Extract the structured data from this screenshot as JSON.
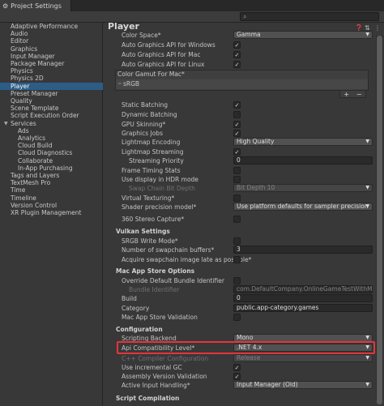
{
  "window": {
    "title": "Project Settings"
  },
  "sidebar": {
    "items": [
      {
        "label": "Adaptive Performance"
      },
      {
        "label": "Audio"
      },
      {
        "label": "Editor"
      },
      {
        "label": "Graphics"
      },
      {
        "label": "Input Manager"
      },
      {
        "label": "Package Manager"
      },
      {
        "label": "Physics"
      },
      {
        "label": "Physics 2D"
      },
      {
        "label": "Player",
        "selected": true
      },
      {
        "label": "Preset Manager"
      },
      {
        "label": "Quality"
      },
      {
        "label": "Scene Template"
      },
      {
        "label": "Script Execution Order"
      },
      {
        "label": "Services",
        "expanded": true
      },
      {
        "label": "Ads"
      },
      {
        "label": "Analytics"
      },
      {
        "label": "Cloud Build"
      },
      {
        "label": "Cloud Diagnostics"
      },
      {
        "label": "Collaborate"
      },
      {
        "label": "In-App Purchasing"
      },
      {
        "label": "Tags and Layers"
      },
      {
        "label": "TextMesh Pro"
      },
      {
        "label": "Time"
      },
      {
        "label": "Timeline"
      },
      {
        "label": "Version Control"
      },
      {
        "label": "XR Plugin Management"
      }
    ]
  },
  "main": {
    "title": "Player",
    "header_icons": [
      "help-icon",
      "presets-icon",
      "menu-icon"
    ],
    "rows": {
      "color_space": {
        "label": "Color Space*",
        "value": "Gamma"
      },
      "auto_gfx_windows": {
        "label": "Auto Graphics API  for Windows",
        "checked": true
      },
      "auto_gfx_mac": {
        "label": "Auto Graphics API  for Mac",
        "checked": true
      },
      "auto_gfx_linux": {
        "label": "Auto Graphics API  for Linux",
        "checked": true
      },
      "color_gamut": {
        "title": "Color Gamut For Mac*",
        "value": "sRGB",
        "add": "+",
        "remove": "−"
      },
      "static_batching": {
        "label": "Static Batching",
        "checked": true
      },
      "dynamic_batching": {
        "label": "Dynamic Batching",
        "checked": false
      },
      "gpu_skinning": {
        "label": "GPU Skinning*",
        "checked": true
      },
      "graphics_jobs": {
        "label": "Graphics Jobs",
        "checked": true
      },
      "lightmap_encoding": {
        "label": "Lightmap Encoding",
        "value": "High Quality"
      },
      "lightmap_streaming": {
        "label": "Lightmap Streaming",
        "checked": true
      },
      "streaming_priority": {
        "label": "Streaming Priority",
        "value": "0"
      },
      "frame_timing": {
        "label": "Frame Timing Stats",
        "checked": false
      },
      "hdr_display": {
        "label": "Use display in HDR mode",
        "checked": false
      },
      "swap_chain_depth": {
        "label": "Swap Chain Bit Depth",
        "value": "Bit Depth 10"
      },
      "virtual_texturing": {
        "label": "Virtual Texturing*",
        "checked": false
      },
      "shader_precision": {
        "label": "Shader precision model*",
        "value": "Use platform defaults for sampler precision"
      },
      "stereo_capture": {
        "label": "360 Stereo Capture*",
        "checked": false
      },
      "vulkan_section": {
        "label": "Vulkan Settings"
      },
      "srgb_write": {
        "label": "SRGB Write Mode*",
        "checked": false
      },
      "swapchain_buffers": {
        "label": "Number of swapchain buffers*",
        "value": "3"
      },
      "acquire_late": {
        "label": "Acquire swapchain image late as possible*",
        "checked": false
      },
      "mac_store_section": {
        "label": "Mac App Store Options"
      },
      "override_bundle": {
        "label": "Override Default Bundle Identifier",
        "checked": false
      },
      "bundle_identifier": {
        "label": "Bundle Identifier",
        "value": "com.DefaultCompany.OnlineGameTestWithMirror"
      },
      "build": {
        "label": "Build",
        "value": "0"
      },
      "category": {
        "label": "Category",
        "value": "public.app-category.games"
      },
      "mac_store_validation": {
        "label": "Mac App Store Validation",
        "checked": false
      },
      "config_section": {
        "label": "Configuration"
      },
      "scripting_backend": {
        "label": "Scripting Backend",
        "value": "Mono"
      },
      "api_compat": {
        "label": "Api Compatibility Level*",
        "value": ".NET 4.x"
      },
      "cpp_compiler": {
        "label": "C++ Compiler Configuration",
        "value": "Release"
      },
      "incremental_gc": {
        "label": "Use incremental GC",
        "checked": true
      },
      "assembly_validation": {
        "label": "Assembly Version Validation",
        "checked": true
      },
      "active_input": {
        "label": "Active Input Handling*",
        "value": "Input Manager (Old)"
      },
      "script_compilation": {
        "label": "Script Compilation"
      }
    }
  },
  "colors": {
    "selection": "#2c5d87",
    "highlight": "#e8333b",
    "background": "#383838"
  }
}
